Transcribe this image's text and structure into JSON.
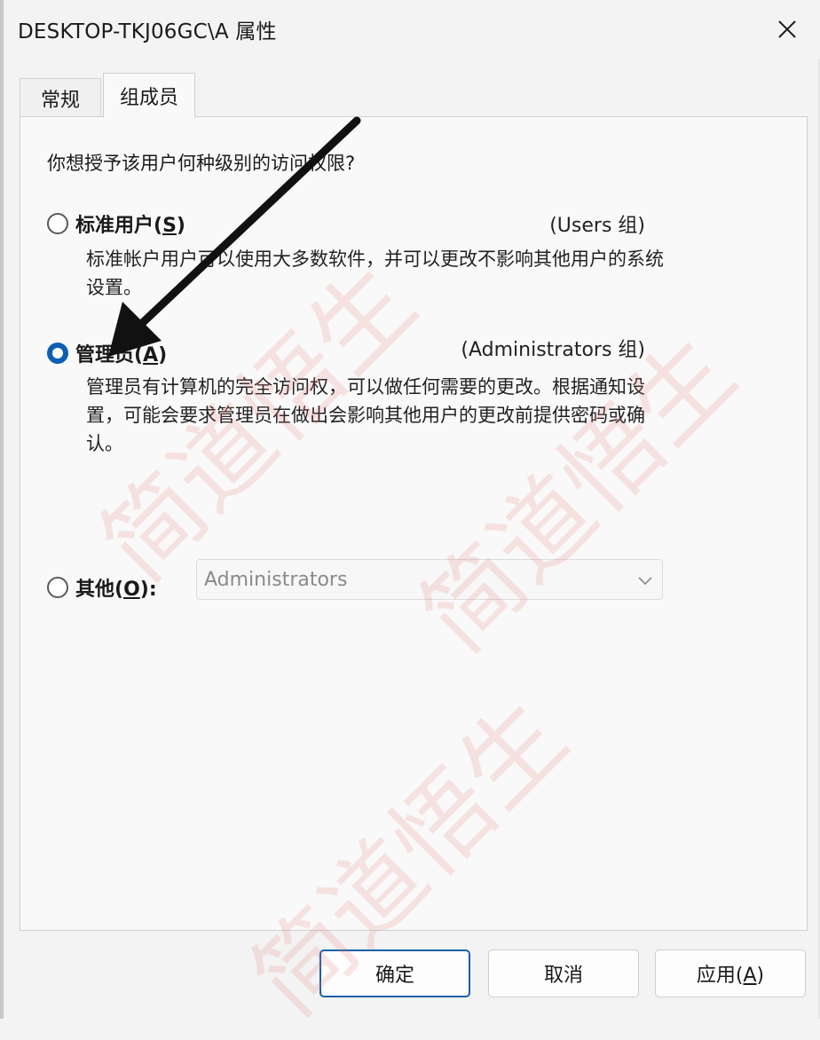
{
  "window": {
    "title": "DESKTOP-TKJ06GC\\A 属性"
  },
  "tabs": [
    {
      "label": "常规"
    },
    {
      "label": "组成员"
    }
  ],
  "panel": {
    "question": "你想授予该用户何种级别的访问权限?",
    "options": [
      {
        "label_main": "标准用户(",
        "label_key": "S",
        "label_end": ")",
        "group": "(Users 组)",
        "description": "标准帐户用户可以使用大多数软件，并可以更改不影响其他用户的系统设置。",
        "selected": false
      },
      {
        "label_main": "管理员(",
        "label_key": "A",
        "label_end": ")",
        "group": "(Administrators 组)",
        "description": "管理员有计算机的完全访问权，可以做任何需要的更改。根据通知设置，可能会要求管理员在做出会影响其他用户的更改前提供密码或确认。",
        "selected": true
      },
      {
        "label_main": "其他(",
        "label_key": "O",
        "label_end": "):",
        "selected": false
      }
    ],
    "other_group_select": {
      "value": "Administrators"
    }
  },
  "buttons": {
    "ok": "确定",
    "cancel": "取消",
    "apply_main": "应用(",
    "apply_key": "A",
    "apply_end": ")"
  },
  "watermark": "简道悟生",
  "colors": {
    "accent": "#0a5fb4",
    "primary_button_border": "#1a5ea8",
    "watermark": "#e6786e"
  }
}
